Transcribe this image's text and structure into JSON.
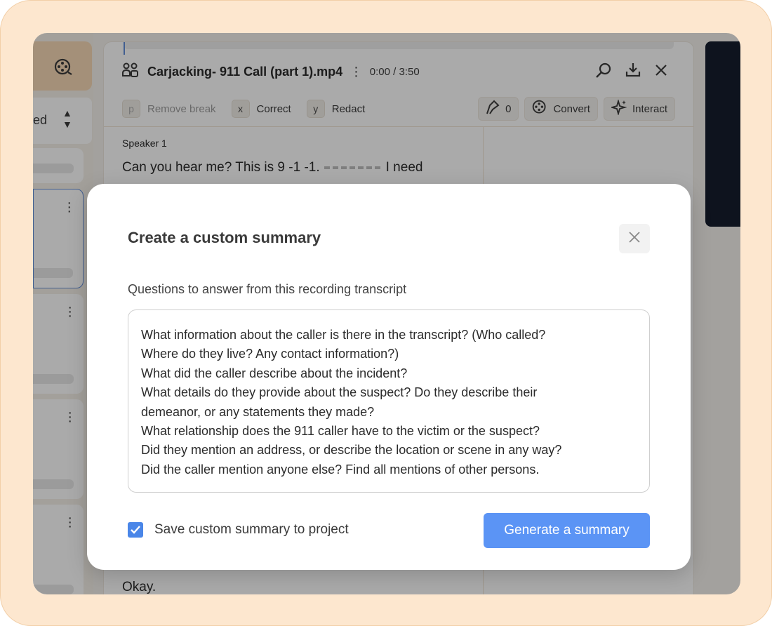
{
  "app": {
    "left_panel": {
      "sort_label": "ed"
    },
    "file": {
      "title": "Carjacking- 911 Call (part 1).mp4",
      "time": "0:00 / 3:50"
    },
    "toolbar": {
      "remove_break": {
        "key": "p",
        "label": "Remove break"
      },
      "correct": {
        "key": "x",
        "label": "Correct"
      },
      "redact": {
        "key": "y",
        "label": "Redact"
      },
      "marks_count": "0",
      "convert_label": "Convert",
      "interact_label": "Interact"
    },
    "transcript": {
      "speaker": "Speaker 1",
      "line1_start": "Can you hear me? This is 9 -1 -1.",
      "line1_end": "I need",
      "last_line": "Okay."
    }
  },
  "modal": {
    "title": "Create a custom summary",
    "questions_label": "Questions to answer from this recording transcript",
    "questions": [
      "What information about the caller is there in the transcript? (Who called?",
      "Where do they live? Any contact information?)",
      "What did the caller describe about the incident?",
      "What details do they provide about the suspect? Do they describe their",
      "demeanor, or any statements they made?",
      "What relationship does the 911 caller have to the victim or the suspect?",
      "Did they mention an address, or describe the location or scene in any way?",
      "Did the caller mention anyone else? Find all mentions of other persons."
    ],
    "save_to_project_label": "Save custom summary to project",
    "save_to_project_checked": true,
    "generate_label": "Generate a summary"
  },
  "colors": {
    "frame": "#fde7cf",
    "accent": "#5b94f5",
    "checkbox": "#4a86e8"
  }
}
